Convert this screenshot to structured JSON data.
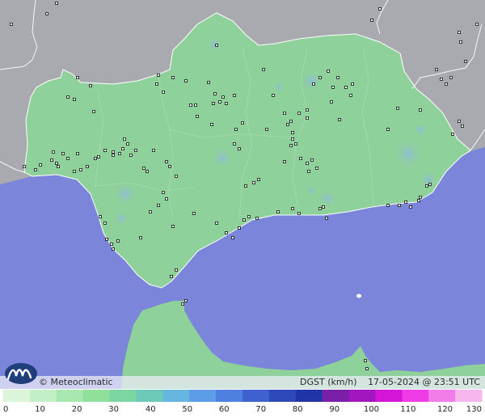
{
  "map": {
    "region": "Andalusia",
    "land_color": "#8fd19a",
    "sea_color": "#7b85d9",
    "outside_land_color": "#a9a9b0",
    "border_color": "#ffffff"
  },
  "footer": {
    "credit": "© Meteoclimatic",
    "variable": "DGST (km/h)",
    "timestamp": "17-05-2024 @ 23:51 UTC"
  },
  "legend": {
    "ticks": [
      "0",
      "10",
      "20",
      "30",
      "40",
      "50",
      "60",
      "70",
      "80",
      "90",
      "100",
      "110",
      "120",
      "130"
    ],
    "colors": [
      "#dbf5db",
      "#c3efc6",
      "#a8e8b0",
      "#8fe09a",
      "#7bd6a2",
      "#6dcab8",
      "#66b6df",
      "#5d9de8",
      "#4f7fe0",
      "#3f61cf",
      "#2e49b9",
      "#2036a8",
      "#7a1fa8",
      "#a216c0",
      "#d414d6",
      "#ef3ce6",
      "#f27ce9",
      "#f6b7ef"
    ]
  },
  "icons": {
    "logo": "meteoclimatic-logo-icon",
    "station": "station-marker-icon"
  }
}
